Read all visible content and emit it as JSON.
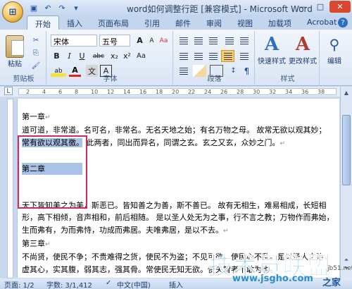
{
  "window": {
    "title": "word如何调整行距 [兼容模式] - Microsoft Word",
    "office_button_icon": "office-logo-icon",
    "quick_access": [
      "save-icon",
      "undo-icon",
      "redo-icon",
      "customize-icon"
    ],
    "controls": [
      "—",
      "□",
      "✕"
    ]
  },
  "tabs": [
    "开始",
    "插入",
    "页面布局",
    "引用",
    "邮件",
    "审阅",
    "视图",
    "加载项",
    "Acrobat"
  ],
  "ribbon": {
    "clipboard": {
      "paste_label": "粘贴",
      "group_label": "剪贴板"
    },
    "font": {
      "font_name": "宋体",
      "font_size": "五号",
      "grow": "A",
      "shrink": "A",
      "clear": "Aa",
      "bold": "B",
      "italic": "I",
      "underline": "U",
      "strike": "abc",
      "sub": "x₂",
      "sup": "x²",
      "case": "Aa",
      "highlight": "ab",
      "color": "A",
      "wen": "文",
      "char_border": "A",
      "group_label": "字体"
    },
    "paragraph": {
      "group_label": "段落"
    },
    "styles": {
      "quick_label": "快速样式",
      "change_label": "更改样式",
      "group_label": "样式"
    },
    "editing": {
      "label": "编辑"
    }
  },
  "ruler": {
    "ticks": [
      "2",
      "4",
      "6",
      "8",
      "10",
      "12",
      "14",
      "16",
      "18",
      "20",
      "22",
      "24",
      "26",
      "28",
      "30",
      "32",
      "34",
      "36",
      "38"
    ]
  },
  "document": {
    "lines": [
      "第一章",
      "道可道，非常道。名可名，非常名。无名天地之始；有名万物之母。 故常无欲以观其妙；",
      "常有欲以观其徼。 此两者，同出而异名，同谓之玄。玄之又玄，众妙之门。",
      "",
      "第二章",
      "",
      "",
      "天下皆知美之为美，斯恶已。皆知善之为善，斯不善已。 故有无相生，难易相成，长短相",
      "形，高下相倾，音声相和，前后相随。 是以圣人处无为之事，行不言之教；万物作而弗始，",
      "生而弗有，为而弗恃，功成而弗居。夫唯弗居，是以不去。",
      "第三章",
      "不尚贤，使民不争；不贵难得之货，使民不为盗；不见可欲，使民心不乱。是以圣人之治，",
      "虚其心，实其腹，弱其志，强其骨。常使民无知无欲。使夫智者不敢为也。"
    ],
    "return_mark": "↵"
  },
  "statusbar": {
    "page": "页面: 1/2",
    "words": "字数: 3/1,412",
    "lang": "中文(中国)",
    "mode": "插入"
  },
  "watermark": {
    "main": "技术员联盟",
    "url": "www.jsgho.com",
    "site": "jb51.net",
    "tail": "之家"
  }
}
